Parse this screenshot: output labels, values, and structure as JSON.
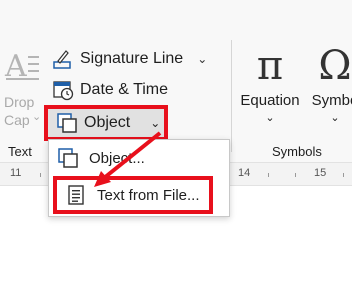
{
  "ribbon": {
    "drop_cap": {
      "line1": "Drop",
      "line2": "Cap",
      "chevron": "⌄"
    },
    "text_group": {
      "label": "Text",
      "signature_line": {
        "label": "Signature Line",
        "chevron": "⌄"
      },
      "date_time": {
        "label": "Date & Time"
      },
      "object": {
        "label": "Object",
        "chevron": "⌄"
      }
    },
    "symbols_group": {
      "label": "Symbols",
      "equation": {
        "glyph": "π",
        "label": "Equation",
        "chevron": "⌄"
      },
      "symbol": {
        "glyph": "Ω",
        "label": "Symbo",
        "chevron": "⌄"
      }
    }
  },
  "ruler": {
    "numbers": [
      "11",
      "14",
      "15"
    ]
  },
  "object_menu": {
    "items": [
      {
        "label": "Object..."
      },
      {
        "label": "Text from File..."
      }
    ]
  },
  "highlight_color": "#e8101c",
  "icons": [
    "drop-cap-icon",
    "signature-line-icon",
    "date-time-icon",
    "object-icon",
    "text-file-icon"
  ]
}
